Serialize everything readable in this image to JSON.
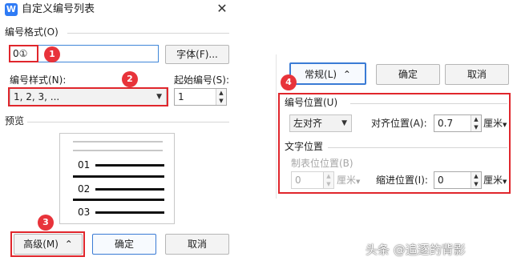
{
  "dialog": {
    "title": "自定义编号列表",
    "logo_letter": "W",
    "close_glyph": "✕"
  },
  "number_format": {
    "label": "编号格式(O)",
    "value": "0①",
    "font_button": "字体(F)..."
  },
  "number_style": {
    "label": "编号样式(N):",
    "value": "1, 2, 3, ..."
  },
  "start_at": {
    "label": "起始编号(S):",
    "value": "1"
  },
  "preview": {
    "label": "预览",
    "numbers": [
      "01",
      "02",
      "03"
    ]
  },
  "buttons": {
    "advanced": "高级(M)",
    "advanced_glyph": "⌃",
    "ok": "确定",
    "cancel": "取消"
  },
  "badges": [
    "1",
    "2",
    "3",
    "4"
  ],
  "right_panel": {
    "normal_button": "常规(L)",
    "normal_glyph": "⌃",
    "ok": "确定",
    "cancel": "取消",
    "number_position": {
      "label": "编号位置(U)",
      "align_value": "左对齐",
      "align_at_label": "对齐位置(A):",
      "align_at_value": "0.7",
      "align_at_unit": "厘米"
    },
    "text_position": {
      "label": "文字位置",
      "tab_label": "制表位位置(B)",
      "tab_value": "0",
      "tab_unit": "厘米",
      "indent_label": "缩进位置(I):",
      "indent_value": "0",
      "indent_unit": "厘米"
    }
  },
  "watermark": "头条 @追逐的背影",
  "colors": {
    "accent": "#3a7bd5",
    "callout": "#e0262c",
    "badge": "#e8333a",
    "logo": "#2f7bf5"
  }
}
